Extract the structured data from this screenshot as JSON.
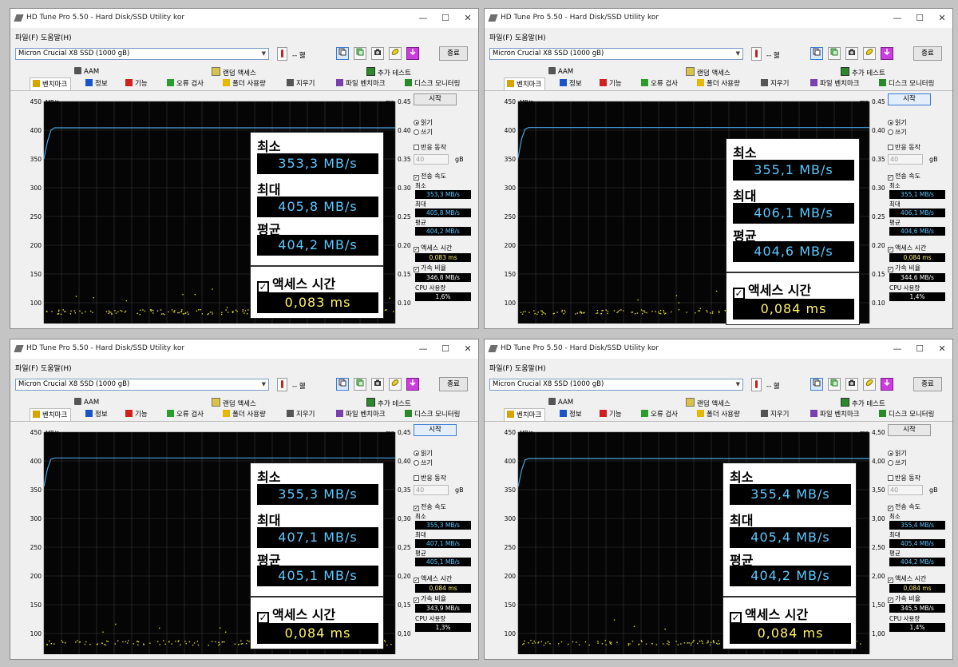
{
  "app": {
    "title": "HD Tune Pro 5.50 - Hard Disk/SSD Utility kor",
    "window_controls": [
      "—",
      "☐",
      "✕"
    ],
    "menu": [
      "파일(F)",
      "도움말(H)"
    ],
    "drive": "Micron  Crucial X8 SSD (1000 gB)",
    "temperature": "-- 혫",
    "toolbar_icons": [
      "copy-icon",
      "copy-green-icon",
      "camera-icon",
      "pill-icon",
      "download-icon"
    ],
    "quit_label": "종료",
    "tabs_top": [
      {
        "label": "AAM",
        "icon": "speaker-icon"
      },
      {
        "label": "랜덤 액세스",
        "icon": "random-access-icon"
      },
      {
        "label": "추가 테스트",
        "icon": "extra-test-icon"
      }
    ],
    "tabs_bottom": [
      {
        "label": "벤치마크",
        "icon": "bulb-icon",
        "color": "#d8a400"
      },
      {
        "label": "정보",
        "icon": "info-icon",
        "color": "#1a55c7"
      },
      {
        "label": "기능",
        "icon": "plus-icon",
        "color": "#d02020"
      },
      {
        "label": "오류 검사",
        "icon": "magnifier-icon",
        "color": "#2a9d2a"
      },
      {
        "label": "폴더 사용량",
        "icon": "folder-icon",
        "color": "#e6b800"
      },
      {
        "label": "지우기",
        "icon": "trash-icon",
        "color": "#555555"
      },
      {
        "label": "파일 벤치마크",
        "icon": "file-bench-icon",
        "color": "#7a3fb0"
      },
      {
        "label": "디스크 모니터링",
        "icon": "monitor-icon",
        "color": "#2a8a2a"
      }
    ],
    "side": {
      "start_label": "시작",
      "read_label": "읽기",
      "write_label": "쓰기",
      "block_label": "반응 동작",
      "block_value": "40",
      "block_unit": "gB",
      "transfer_label": "전송 속도",
      "min_label": "최소",
      "max_label": "최대",
      "avg_label": "평균",
      "access_label": "액세스 시간",
      "burst_label": "가속 비율",
      "cpu_label": "CPU 사용량"
    },
    "axis": {
      "left_unit": "MB/s",
      "right_unit": "ms",
      "left_ticks": [
        "450",
        "400",
        "350",
        "300",
        "250",
        "200",
        "150",
        "100"
      ],
      "right_ticks_a": [
        "0.45",
        "0.40",
        "0.35",
        "0.30",
        "0.25",
        "0.20",
        "0.15",
        "0.10"
      ],
      "right_ticks_b": [
        "0,45",
        "0,40",
        "0,35",
        "0,30",
        "0,25",
        "0,20",
        "0,15",
        "0,10"
      ],
      "right_ticks_c": [
        "4,50",
        "4,00",
        "3,50",
        "3,00",
        "2,50",
        "2,00",
        "1,50",
        "1,00"
      ]
    },
    "colors": {
      "chart_bg": "#050505",
      "grid": "#3a3a3a",
      "line": "#4aa3e0",
      "scatter": "#d8d830",
      "accent": "#3a7bd5"
    }
  },
  "windows": [
    {
      "right_ticks": "right_ticks_a",
      "start_focused": false,
      "stats": {
        "min": "353,3 MB/s",
        "max": "405,8 MB/s",
        "avg": "404,2 MB/s",
        "access": "0,083 ms",
        "burst": "346,8 MB/s",
        "cpu": "1,6%"
      },
      "zoom": {
        "min_label": "최소",
        "max_label": "최대",
        "avg_label": "평균",
        "min": "353,3 MB/s",
        "max": "405,8 MB/s",
        "avg": "404,2 MB/s",
        "access_label": "액세스 시간",
        "access": "0,083 ms"
      }
    },
    {
      "right_ticks": "right_ticks_a",
      "start_focused": true,
      "stats": {
        "min": "355,1 MB/s",
        "max": "406,1 MB/s",
        "avg": "404,6 MB/s",
        "access": "0,084 ms",
        "burst": "344,6 MB/s",
        "cpu": "1,4%"
      },
      "zoom": {
        "min_label": "최소",
        "max_label": "최대",
        "avg_label": "평균",
        "min": "355,1 MB/s",
        "max": "406,1 MB/s",
        "avg": "404,6 MB/s",
        "access_label": "액세스 시간",
        "access": "0,084 ms"
      }
    },
    {
      "right_ticks": "right_ticks_b",
      "start_focused": true,
      "stats": {
        "min": "355,3 MB/s",
        "max": "407,1 MB/s",
        "avg": "405,1 MB/s",
        "access": "0,084 ms",
        "burst": "343,9 MB/s",
        "cpu": "1,3%"
      },
      "zoom": {
        "min_label": "최소",
        "max_label": "최대",
        "avg_label": "평균",
        "min": "355,3 MB/s",
        "max": "407,1 MB/s",
        "avg": "405,1 MB/s",
        "access_label": "액세스 시간",
        "access": "0,084 ms"
      }
    },
    {
      "right_ticks": "right_ticks_c",
      "start_focused": false,
      "stats": {
        "min": "355,4 MB/s",
        "max": "405,4 MB/s",
        "avg": "404,2 MB/s",
        "access": "0,084 ms",
        "burst": "345,5 MB/s",
        "cpu": "1,4%"
      },
      "zoom": {
        "min_label": "최소",
        "max_label": "최대",
        "avg_label": "평균",
        "min": "355,4 MB/s",
        "max": "405,4 MB/s",
        "avg": "404,2 MB/s",
        "access_label": "액세스 시간",
        "access": "0,084 ms"
      }
    }
  ],
  "chart_data": [
    {
      "type": "line",
      "xlabel": "",
      "ylabel": "MB/s",
      "ylim": [
        0,
        450
      ],
      "x": [
        0,
        1,
        2,
        3,
        100
      ],
      "series": [
        {
          "values": [
            350,
            380,
            400,
            404.2,
            404.2
          ]
        }
      ]
    },
    {
      "type": "line",
      "xlabel": "",
      "ylabel": "MB/s",
      "ylim": [
        0,
        450
      ],
      "x": [
        0,
        1,
        2,
        3,
        100
      ],
      "series": [
        {
          "values": [
            352,
            385,
            402,
            404.6,
            404.6
          ]
        }
      ]
    },
    {
      "type": "line",
      "xlabel": "",
      "ylabel": "MB/s",
      "ylim": [
        0,
        450
      ],
      "x": [
        0,
        1,
        2,
        3,
        100
      ],
      "series": [
        {
          "values": [
            355,
            386,
            403,
            405.1,
            405.1
          ]
        }
      ]
    },
    {
      "type": "line",
      "xlabel": "",
      "ylabel": "MB/s",
      "ylim": [
        0,
        450
      ],
      "x": [
        0,
        1,
        2,
        3,
        100
      ],
      "series": [
        {
          "values": [
            355,
            384,
            402,
            404.2,
            404.2
          ]
        }
      ]
    }
  ]
}
